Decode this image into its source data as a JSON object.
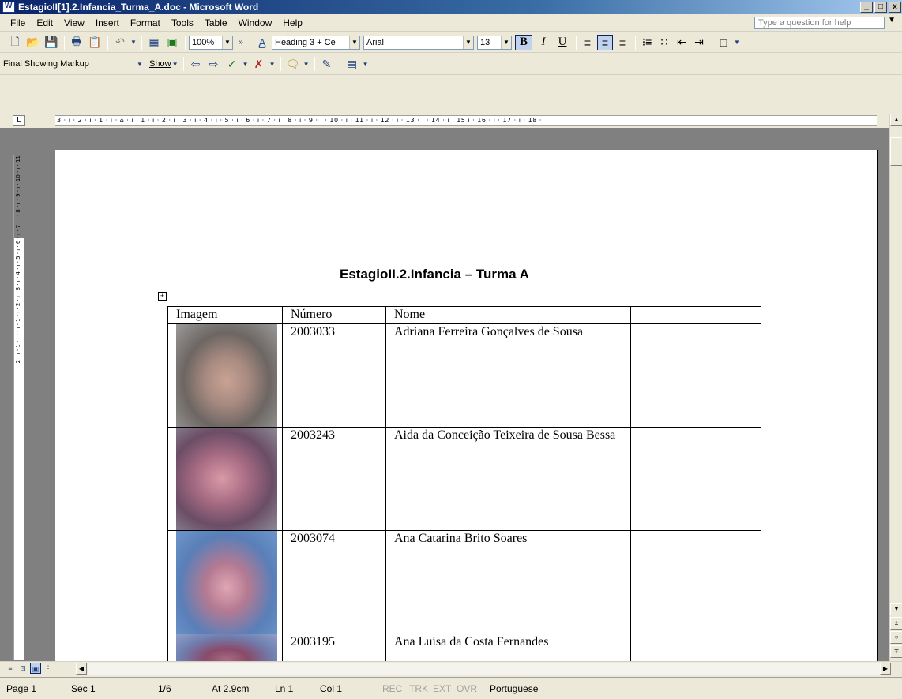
{
  "window": {
    "title": "EstagioII[1].2.Infancia_Turma_A.doc - Microsoft Word",
    "buttons": [
      "_",
      "□",
      "x"
    ]
  },
  "menu": {
    "items": [
      "File",
      "Edit",
      "View",
      "Insert",
      "Format",
      "Tools",
      "Table",
      "Window",
      "Help"
    ],
    "help_placeholder": "Type a question for help"
  },
  "toolbar_standard": {
    "zoom": "100%",
    "style": "Heading 3 + Ce",
    "font": "Arial",
    "size": "13"
  },
  "toolbar_review": {
    "display_mode": "Final Showing Markup",
    "show_label": "Show"
  },
  "ruler": {
    "horizontal_text": "3 · ı · 2 · ı · 1 · ı · ⌂ · ı · 1 · ı · 2 · ı · 3 · ı · 4 · ı · 5 · ı · 6 · ı · 7 · ı · 8 · ı · 9 · ı · 10 · ı · 11 · ı · 12 · ı · 13 · ı · 14 · ı · 15 ı · 16 · ı · 17 · ı · 18 ·",
    "vertical_text": "2 · ı · 1 · ı · · ı · 1 · ı · 2 · ı · 3 · ı · 4 · ı · 5 · ı · 6 · ı · 7 · ı · 8 · ı · 9 · ı · 10 · ı · 11"
  },
  "document": {
    "title": "EstagioII.2.Infancia – Turma A",
    "table": {
      "headers": [
        "Imagem",
        "Número",
        "Nome",
        ""
      ],
      "rows": [
        {
          "numero": "2003033",
          "nome": "Adriana Ferreira Gonçalves de Sousa"
        },
        {
          "numero": "2003243",
          "nome": "Aida da Conceição Teixeira de Sousa Bessa"
        },
        {
          "numero": "2003074",
          "nome": "Ana Catarina Brito Soares"
        },
        {
          "numero": "2003195",
          "nome": "Ana Luísa da Costa Fernandes"
        }
      ]
    }
  },
  "status": {
    "page": "Page 1",
    "sec": "Sec 1",
    "pages": "1/6",
    "at": "At 2.9cm",
    "ln": "Ln 1",
    "col": "Col 1",
    "rec": "REC",
    "trk": "TRK",
    "ext": "EXT",
    "ovr": "OVR",
    "language": "Portuguese"
  },
  "colors": {
    "titlebar_start": "#0a246a",
    "chrome": "#ece9d8",
    "workspace": "#808080"
  }
}
